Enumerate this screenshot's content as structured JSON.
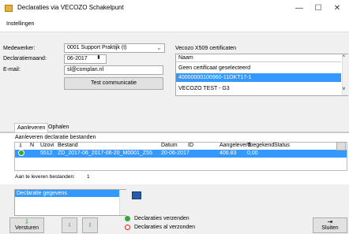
{
  "window": {
    "title": "Declaraties via VECOZO Schakelpunt",
    "minimize": "—",
    "maximize": "☐",
    "close": "✕"
  },
  "menu": {
    "items": [
      "Instellingen"
    ]
  },
  "form": {
    "medewerker_label": "Medewerker:",
    "medewerker_value": "0001 Support Praktijk (t)",
    "declaratiemaand_label": "Declaratiemaand:",
    "declaratiemaand_value": "06-2017",
    "email_label": "E-mail:",
    "email_value": "sl@complan.nl",
    "test_button": "Test communicatie"
  },
  "certificates": {
    "label": "Vecozo X509 certificaten",
    "header": "Naam",
    "items": [
      {
        "label": "Geen certificaat geselecteerd",
        "selected": false
      },
      {
        "label": "40000000100960-11OKT17-1",
        "selected": true
      },
      {
        "label": "VECOZO TEST - G3",
        "selected": false
      }
    ]
  },
  "tabs": [
    {
      "label": "Aanleveren",
      "active": true
    },
    {
      "label": "Ophalen",
      "active": false
    }
  ],
  "aanleveren": {
    "section_title": "Aanleveren declaratie bestanden",
    "columns": [
      "N",
      "Uzovi",
      "Bestand",
      "Datum",
      "ID",
      "Aangeleverd",
      "Toegekend",
      "Status"
    ],
    "rows": [
      {
        "n": "",
        "uzovi": "5512",
        "bestand": "ZD_2017-06_2017-06-20_M0001_Z55",
        "datum": "20-06-2017",
        "id": "",
        "aangeleverd": "406.83",
        "toegekend": "0,00",
        "status": ""
      }
    ],
    "count_label": "Aan te leveren bestanden:",
    "count_value": "1"
  },
  "declaratie_gegevens": {
    "label": "Declaratie gegevens"
  },
  "legend": {
    "verzenden": "Declaraties verzenden",
    "al_verzonden": "Declaraties al verzonden"
  },
  "buttons": {
    "versturen": "Versturen",
    "sluiten": "Sluiten"
  },
  "colors": {
    "selection": "#3399ff",
    "accent_green": "#3aa53a",
    "warn_red": "#d9252b"
  }
}
